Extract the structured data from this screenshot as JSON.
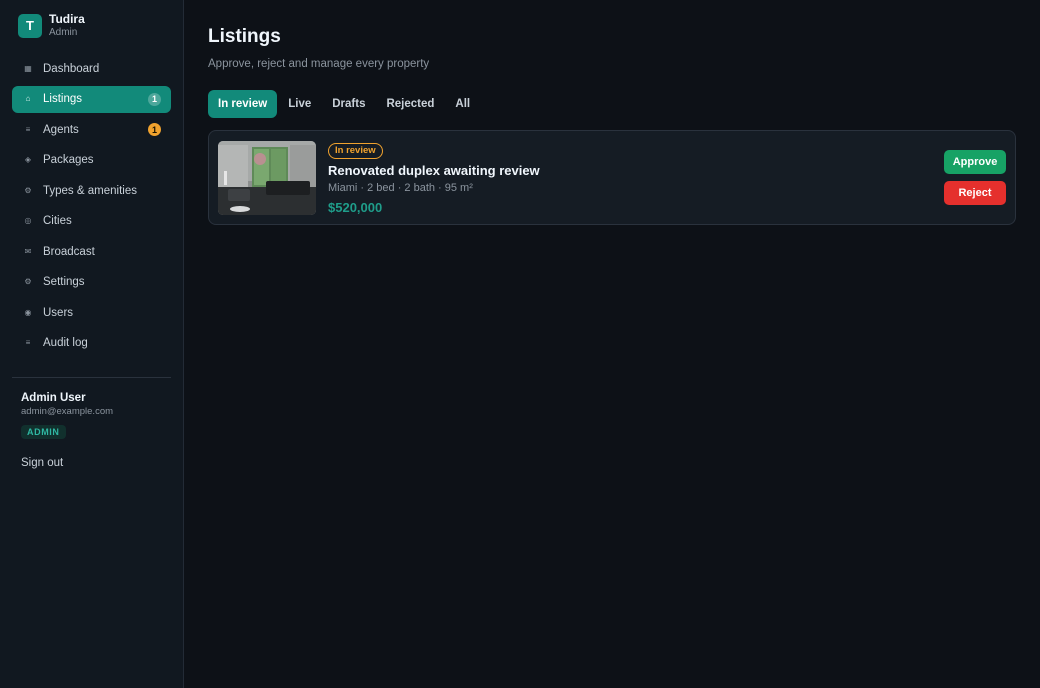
{
  "brand": {
    "logo_letter": "T",
    "name": "Tudira",
    "role": "Admin"
  },
  "nav": {
    "items": [
      {
        "label": "Dashboard",
        "icon": "▦",
        "icon_name": "dashboard-icon"
      },
      {
        "label": "Listings",
        "icon": "⌂",
        "icon_name": "home-icon",
        "badge": "1",
        "active": true
      },
      {
        "label": "Agents",
        "icon": "≡",
        "icon_name": "agents-icon",
        "badge": "1"
      },
      {
        "label": "Packages",
        "icon": "◈",
        "icon_name": "package-icon"
      },
      {
        "label": "Types & amenities",
        "icon": "⚙",
        "icon_name": "tag-icon"
      },
      {
        "label": "Cities",
        "icon": "◎",
        "icon_name": "city-icon"
      },
      {
        "label": "Broadcast",
        "icon": "✉",
        "icon_name": "broadcast-icon"
      },
      {
        "label": "Settings",
        "icon": "⚙",
        "icon_name": "settings-icon"
      },
      {
        "label": "Users",
        "icon": "◉",
        "icon_name": "users-icon"
      },
      {
        "label": "Audit log",
        "icon": "≡",
        "icon_name": "audit-log-icon"
      }
    ]
  },
  "user": {
    "name": "Admin User",
    "email": "admin@example.com",
    "role": "ADMIN",
    "signout_label": "Sign out"
  },
  "page": {
    "title": "Listings",
    "subtitle": "Approve, reject and manage every property"
  },
  "tabs": [
    {
      "label": "In review",
      "active": true
    },
    {
      "label": "Live"
    },
    {
      "label": "Drafts"
    },
    {
      "label": "Rejected"
    },
    {
      "label": "All"
    }
  ],
  "listing": {
    "status": "In review",
    "title": "Renovated duplex awaiting review",
    "meta": "Miami · 2 bed · 2 bath · 95 m²",
    "price": "$520,000",
    "approve_label": "Approve",
    "reject_label": "Reject"
  },
  "colors": {
    "accent": "#128a7a",
    "warning": "#f0a22e",
    "approve": "#17a265",
    "reject": "#e5302d",
    "price": "#1f9d8a"
  }
}
